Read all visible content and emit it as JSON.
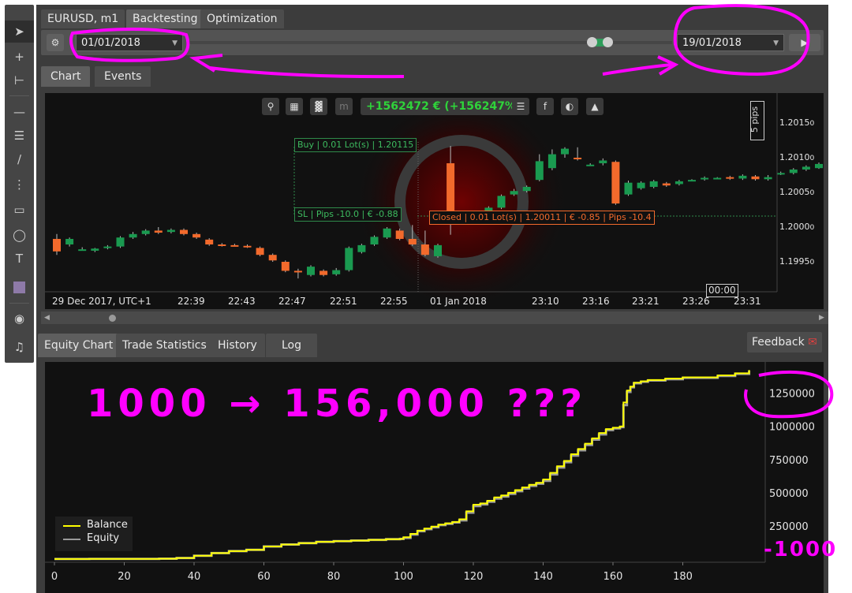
{
  "tabs": {
    "symbol": "EURUSD, m1",
    "backtesting": "Backtesting",
    "optimization": "Optimization"
  },
  "controls": {
    "start_date": "01/01/2018",
    "end_date": "19/01/2018"
  },
  "chart_tabs": {
    "chart": "Chart",
    "events": "Events"
  },
  "pnl": "+1562472 € (+156247%)",
  "price_chart": {
    "y_ticks": [
      "1.2015",
      "1.2010",
      "1.2005",
      "1.2000",
      "1.1995"
    ],
    "y_tick_suffix": "0",
    "x_ticks": [
      "29 Dec 2017, UTC+1",
      "22:39",
      "22:43",
      "22:47",
      "22:51",
      "22:55",
      "01 Jan 2018",
      "23:10",
      "23:16",
      "23:21",
      "23:26",
      "23:31"
    ],
    "scale_label": "5 pips",
    "time_marker": "00:00",
    "buy_tag": [
      "Buy",
      "0.01 Lot(s)",
      "1.20115"
    ],
    "sl_tag": [
      "SL",
      "Pips -10.0",
      "€ -0.88"
    ],
    "closed_tag": [
      "Closed",
      "0.01 Lot(s)",
      "1.20011",
      "€ -0.85",
      "Pips -10.4"
    ],
    "candles": [
      [
        1.19983,
        1.19965,
        1.1999,
        1.1996
      ],
      [
        1.19975,
        1.19983,
        1.19985,
        1.19972
      ],
      [
        1.19968,
        1.19968,
        1.19971,
        1.19966
      ],
      [
        1.19966,
        1.19969,
        1.1997,
        1.19964
      ],
      [
        1.1997,
        1.19972,
        1.19974,
        1.19968
      ],
      [
        1.19972,
        1.19985,
        1.19987,
        1.1997
      ],
      [
        1.19985,
        1.1999,
        1.19993,
        1.19983
      ],
      [
        1.1999,
        1.19995,
        1.19997,
        1.19988
      ],
      [
        1.19995,
        1.19992,
        1.2,
        1.1999
      ],
      [
        1.19993,
        1.19996,
        1.19998,
        1.19991
      ],
      [
        1.19996,
        1.1999,
        1.19998,
        1.19988
      ],
      [
        1.1999,
        1.19985,
        1.19992,
        1.19983
      ],
      [
        1.19982,
        1.19975,
        1.19984,
        1.19973
      ],
      [
        1.19975,
        1.19974,
        1.19977,
        1.19972
      ],
      [
        1.19974,
        1.19973,
        1.19976,
        1.19972
      ],
      [
        1.19973,
        1.19971,
        1.19975,
        1.1997
      ],
      [
        1.1997,
        1.1996,
        1.19972,
        1.19958
      ],
      [
        1.1996,
        1.19952,
        1.19962,
        1.1995
      ],
      [
        1.1995,
        1.19937,
        1.19952,
        1.19935
      ],
      [
        1.19937,
        1.19936,
        1.1994,
        1.19926
      ],
      [
        1.19931,
        1.19943,
        1.19945,
        1.19929
      ],
      [
        1.19937,
        1.19931,
        1.19939,
        1.19929
      ],
      [
        1.19932,
        1.19938,
        1.19941,
        1.1993
      ],
      [
        1.19938,
        1.1997,
        1.19972,
        1.19936
      ],
      [
        1.19964,
        1.19974,
        1.19976,
        1.19962
      ],
      [
        1.19975,
        1.19986,
        1.19988,
        1.19973
      ],
      [
        1.19985,
        1.19998,
        1.2,
        1.19983
      ],
      [
        1.19995,
        1.19983,
        1.19998,
        1.19981
      ],
      [
        1.19983,
        1.19975,
        1.20003,
        1.19973
      ],
      [
        1.19975,
        1.1996,
        1.19995,
        1.19958
      ],
      [
        1.19958,
        1.19974,
        1.19976,
        1.19956
      ],
      [
        1.20092,
        1.20012,
        1.20117,
        1.19989
      ],
      [
        1.20012,
        1.20015,
        1.20017,
        1.2001
      ],
      [
        1.20015,
        1.20018,
        1.2002,
        1.20013
      ],
      [
        1.20023,
        1.20028,
        1.2003,
        1.20021
      ],
      [
        1.20028,
        1.20045,
        1.20047,
        1.20026
      ],
      [
        1.20047,
        1.20052,
        1.20055,
        1.20045
      ],
      [
        1.20052,
        1.20058,
        1.2006,
        1.2005
      ],
      [
        1.20068,
        1.20095,
        1.20105,
        1.20066
      ],
      [
        1.20085,
        1.20105,
        1.20112,
        1.20082
      ],
      [
        1.20105,
        1.20113,
        1.20115,
        1.201
      ],
      [
        1.201,
        1.20098,
        1.20115,
        1.20096
      ],
      [
        1.2009,
        1.2009,
        1.20092,
        1.20088
      ],
      [
        1.20092,
        1.20096,
        1.20099,
        1.20089
      ],
      [
        1.20094,
        1.20034,
        1.20096,
        1.20032
      ],
      [
        1.20047,
        1.20064,
        1.20067,
        1.20045
      ],
      [
        1.20056,
        1.20064,
        1.20066,
        1.20054
      ],
      [
        1.20058,
        1.20066,
        1.20068,
        1.20056
      ],
      [
        1.20063,
        1.2006,
        1.20065,
        1.20058
      ],
      [
        1.20062,
        1.20066,
        1.20068,
        1.2006
      ],
      [
        1.20067,
        1.20068,
        1.20069,
        1.20066
      ],
      [
        1.20069,
        1.20071,
        1.20073,
        1.20067
      ],
      [
        1.20071,
        1.20071,
        1.20072,
        1.2007
      ],
      [
        1.20072,
        1.2007,
        1.20074,
        1.20068
      ],
      [
        1.2007,
        1.20074,
        1.20076,
        1.20068
      ],
      [
        1.20073,
        1.20069,
        1.20075,
        1.20067
      ],
      [
        1.20069,
        1.20072,
        1.20075,
        1.20067
      ],
      [
        1.20076,
        1.20078,
        1.2008,
        1.20075
      ],
      [
        1.20078,
        1.20083,
        1.20085,
        1.20076
      ],
      [
        1.20083,
        1.20087,
        1.20089,
        1.20081
      ],
      [
        1.20085,
        1.20091,
        1.20093,
        1.20084
      ]
    ]
  },
  "bottom_tabs": {
    "equity": "Equity Chart",
    "stats": "Trade Statistics",
    "history": "History",
    "log": "Log"
  },
  "feedback": "Feedback",
  "chart_data": {
    "type": "line",
    "title": "",
    "xlabel": "",
    "ylabel": "",
    "xlim": [
      0,
      200
    ],
    "ylim": [
      0,
      1450000
    ],
    "x_ticks": [
      0,
      20,
      40,
      60,
      80,
      100,
      120,
      140,
      160,
      180
    ],
    "y_ticks": [
      250000,
      500000,
      750000,
      1000000,
      1250000
    ],
    "legend": "bottom-left",
    "grid": false,
    "series": [
      {
        "name": "Balance",
        "color": "#ffff00",
        "x": [
          0,
          10,
          20,
          30,
          35,
          40,
          45,
          50,
          55,
          60,
          65,
          70,
          75,
          80,
          85,
          90,
          95,
          99,
          100,
          102,
          104,
          106,
          108,
          110,
          112,
          114,
          116,
          118,
          120,
          122,
          124,
          126,
          128,
          130,
          132,
          134,
          136,
          138,
          140,
          142,
          144,
          146,
          148,
          150,
          152,
          154,
          156,
          158,
          160,
          162,
          163,
          164,
          165,
          166,
          168,
          170,
          175,
          180,
          190,
          195,
          199
        ],
        "y": [
          1000,
          1200,
          1500,
          3000,
          8000,
          25000,
          45000,
          60000,
          70000,
          95000,
          110000,
          120000,
          130000,
          135000,
          140000,
          145000,
          150000,
          152000,
          165000,
          190000,
          215000,
          230000,
          245000,
          260000,
          270000,
          280000,
          300000,
          360000,
          410000,
          420000,
          440000,
          465000,
          480000,
          500000,
          520000,
          540000,
          560000,
          575000,
          600000,
          650000,
          700000,
          740000,
          790000,
          830000,
          870000,
          910000,
          950000,
          980000,
          990000,
          1000000,
          1180000,
          1270000,
          1300000,
          1330000,
          1340000,
          1350000,
          1360000,
          1370000,
          1385000,
          1400000,
          1425000
        ]
      },
      {
        "name": "Equity",
        "color": "#9a9a9a",
        "x": [
          0,
          10,
          20,
          30,
          35,
          40,
          45,
          50,
          55,
          60,
          65,
          70,
          75,
          80,
          85,
          90,
          95,
          99,
          100,
          102,
          104,
          106,
          108,
          110,
          112,
          114,
          116,
          118,
          120,
          122,
          124,
          126,
          128,
          130,
          132,
          134,
          136,
          138,
          140,
          142,
          144,
          146,
          148,
          150,
          152,
          154,
          156,
          158,
          160,
          162,
          163,
          164,
          165,
          166,
          168,
          170,
          175,
          180,
          190,
          195,
          199
        ],
        "y": [
          1000,
          1200,
          1500,
          3000,
          8000,
          25000,
          45000,
          60000,
          70000,
          95000,
          110000,
          120000,
          130000,
          135000,
          140000,
          145000,
          150000,
          152000,
          160000,
          185000,
          210000,
          226000,
          240000,
          256000,
          266000,
          276000,
          292000,
          350000,
          400000,
          412000,
          432000,
          456000,
          472000,
          492000,
          512000,
          532000,
          552000,
          568000,
          590000,
          638000,
          690000,
          730000,
          780000,
          820000,
          860000,
          900000,
          940000,
          972000,
          985000,
          995000,
          1160000,
          1260000,
          1295000,
          1325000,
          1336000,
          1346000,
          1356000,
          1366000,
          1380000,
          1396000,
          1420000
        ]
      }
    ]
  },
  "annotations": {
    "growth": "1000 → 156,000 ???",
    "start_equity": "1000"
  },
  "colors": {
    "bull": "#1a9a50",
    "bear": "#f26a2c",
    "balance": "#ffff00",
    "equity": "#9a9a9a",
    "marker": "#ff00ff",
    "profit": "#2fd33a"
  }
}
